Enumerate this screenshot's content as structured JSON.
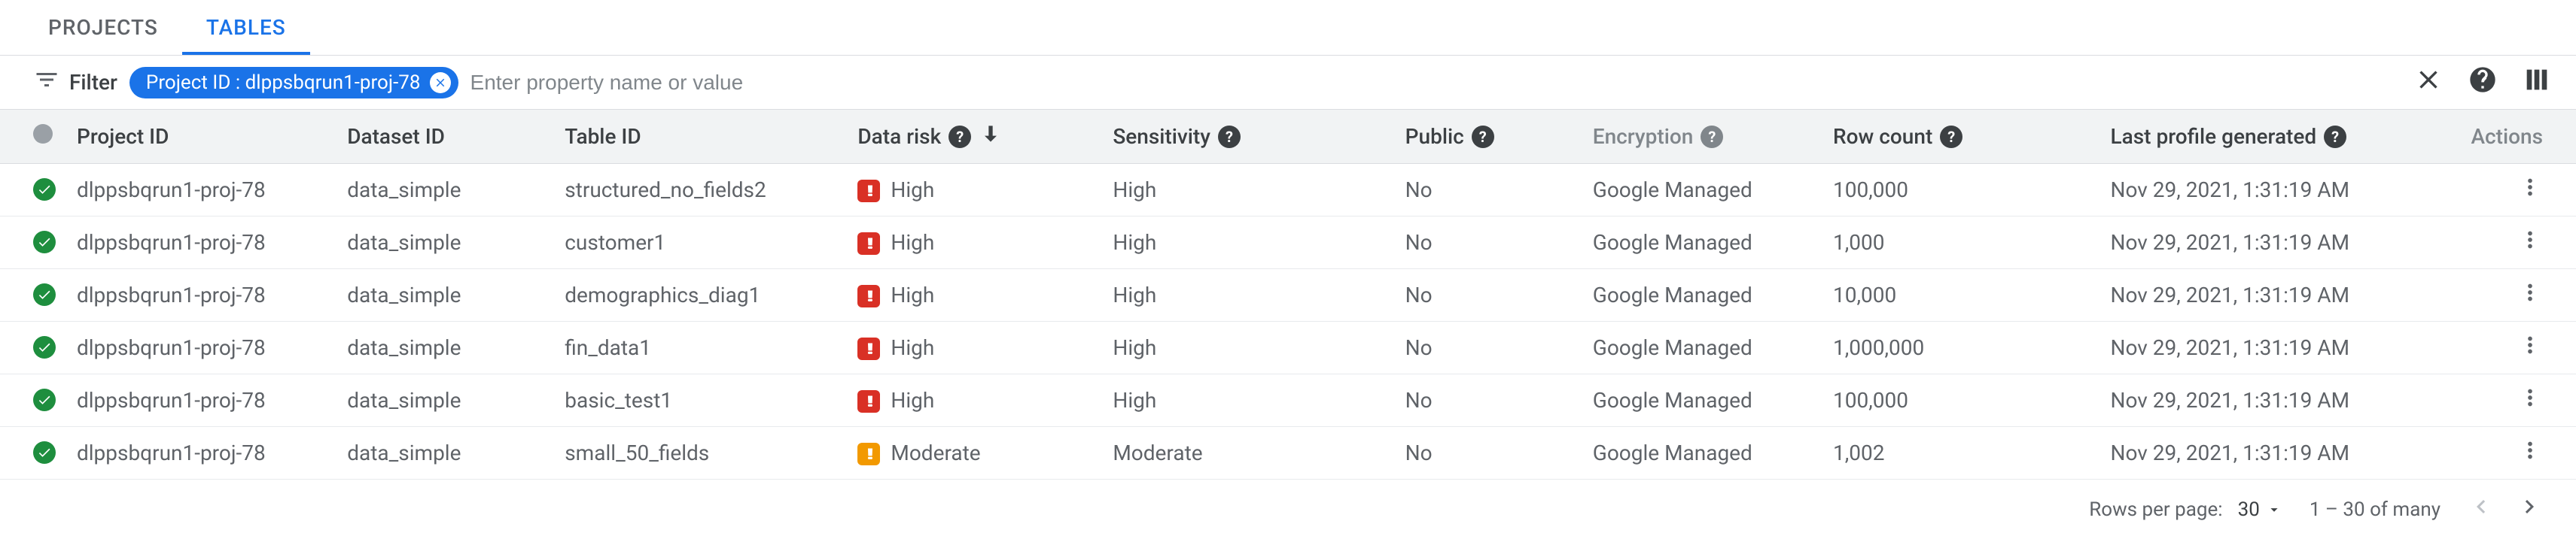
{
  "tabs": {
    "projects": "PROJECTS",
    "tables": "TABLES"
  },
  "filter": {
    "label": "Filter",
    "chip_key": "Project ID",
    "chip_value": "dlppsbqrun1-proj-78",
    "placeholder": "Enter property name or value"
  },
  "columns": {
    "project_id": "Project ID",
    "dataset_id": "Dataset ID",
    "table_id": "Table ID",
    "data_risk": "Data risk",
    "sensitivity": "Sensitivity",
    "public": "Public",
    "encryption": "Encryption",
    "row_count": "Row count",
    "last_generated": "Last profile generated",
    "actions": "Actions"
  },
  "rows": [
    {
      "project_id": "dlppsbqrun1-proj-78",
      "dataset_id": "data_simple",
      "table_id": "structured_no_fields2",
      "risk_level": "high",
      "risk_label": "High",
      "sensitivity": "High",
      "public": "No",
      "encryption": "Google Managed",
      "row_count": "100,000",
      "last_generated": "Nov 29, 2021, 1:31:19 AM"
    },
    {
      "project_id": "dlppsbqrun1-proj-78",
      "dataset_id": "data_simple",
      "table_id": "customer1",
      "risk_level": "high",
      "risk_label": "High",
      "sensitivity": "High",
      "public": "No",
      "encryption": "Google Managed",
      "row_count": "1,000",
      "last_generated": "Nov 29, 2021, 1:31:19 AM"
    },
    {
      "project_id": "dlppsbqrun1-proj-78",
      "dataset_id": "data_simple",
      "table_id": "demographics_diag1",
      "risk_level": "high",
      "risk_label": "High",
      "sensitivity": "High",
      "public": "No",
      "encryption": "Google Managed",
      "row_count": "10,000",
      "last_generated": "Nov 29, 2021, 1:31:19 AM"
    },
    {
      "project_id": "dlppsbqrun1-proj-78",
      "dataset_id": "data_simple",
      "table_id": "fin_data1",
      "risk_level": "high",
      "risk_label": "High",
      "sensitivity": "High",
      "public": "No",
      "encryption": "Google Managed",
      "row_count": "1,000,000",
      "last_generated": "Nov 29, 2021, 1:31:19 AM"
    },
    {
      "project_id": "dlppsbqrun1-proj-78",
      "dataset_id": "data_simple",
      "table_id": "basic_test1",
      "risk_level": "high",
      "risk_label": "High",
      "sensitivity": "High",
      "public": "No",
      "encryption": "Google Managed",
      "row_count": "100,000",
      "last_generated": "Nov 29, 2021, 1:31:19 AM"
    },
    {
      "project_id": "dlppsbqrun1-proj-78",
      "dataset_id": "data_simple",
      "table_id": "small_50_fields",
      "risk_level": "moderate",
      "risk_label": "Moderate",
      "sensitivity": "Moderate",
      "public": "No",
      "encryption": "Google Managed",
      "row_count": "1,002",
      "last_generated": "Nov 29, 2021, 1:31:19 AM"
    }
  ],
  "pagination": {
    "rows_per_page_label": "Rows per page:",
    "rows_per_page_value": "30",
    "range": "1 – 30 of many"
  }
}
